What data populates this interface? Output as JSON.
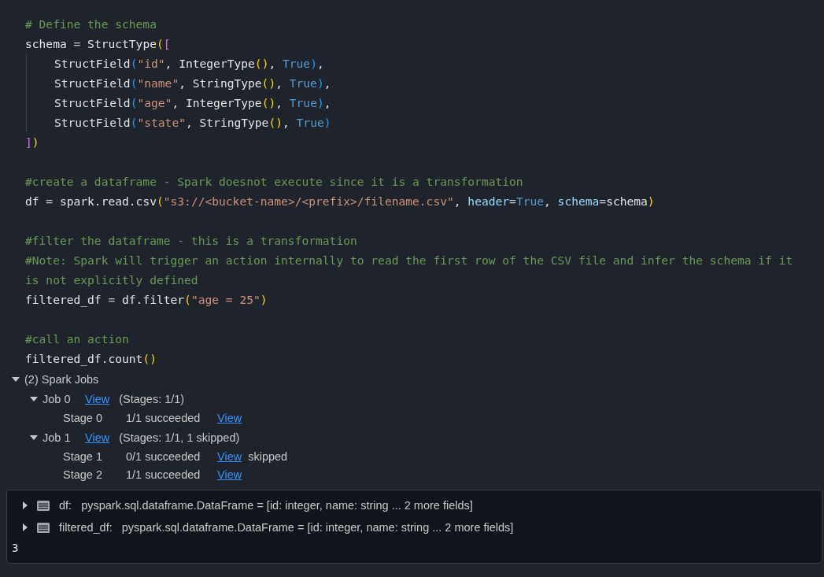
{
  "code_lines": [
    {
      "kind": "code",
      "indented": false,
      "tokens": [
        {
          "kind": "comment",
          "text": "# Define the schema"
        }
      ]
    },
    {
      "kind": "code",
      "indented": false,
      "tokens": [
        {
          "kind": "plain",
          "text": "schema "
        },
        {
          "kind": "op",
          "text": "="
        },
        {
          "kind": "plain",
          "text": " StructType"
        },
        {
          "kind": "paren1",
          "text": "("
        },
        {
          "kind": "paren2",
          "text": "["
        }
      ]
    },
    {
      "kind": "code",
      "indented": true,
      "tokens": [
        {
          "kind": "plain",
          "text": "StructField"
        },
        {
          "kind": "paren3",
          "text": "("
        },
        {
          "kind": "string",
          "text": "\"id\""
        },
        {
          "kind": "plain",
          "text": ", IntegerType"
        },
        {
          "kind": "paren1",
          "text": "()"
        },
        {
          "kind": "plain",
          "text": ", "
        },
        {
          "kind": "keyword",
          "text": "True"
        },
        {
          "kind": "paren3",
          "text": ")"
        },
        {
          "kind": "plain",
          "text": ","
        }
      ]
    },
    {
      "kind": "code",
      "indented": true,
      "tokens": [
        {
          "kind": "plain",
          "text": "StructField"
        },
        {
          "kind": "paren3",
          "text": "("
        },
        {
          "kind": "string",
          "text": "\"name\""
        },
        {
          "kind": "plain",
          "text": ", StringType"
        },
        {
          "kind": "paren1",
          "text": "()"
        },
        {
          "kind": "plain",
          "text": ", "
        },
        {
          "kind": "keyword",
          "text": "True"
        },
        {
          "kind": "paren3",
          "text": ")"
        },
        {
          "kind": "plain",
          "text": ","
        }
      ]
    },
    {
      "kind": "code",
      "indented": true,
      "tokens": [
        {
          "kind": "plain",
          "text": "StructField"
        },
        {
          "kind": "paren3",
          "text": "("
        },
        {
          "kind": "string",
          "text": "\"age\""
        },
        {
          "kind": "plain",
          "text": ", IntegerType"
        },
        {
          "kind": "paren1",
          "text": "()"
        },
        {
          "kind": "plain",
          "text": ", "
        },
        {
          "kind": "keyword",
          "text": "True"
        },
        {
          "kind": "paren3",
          "text": ")"
        },
        {
          "kind": "plain",
          "text": ","
        }
      ]
    },
    {
      "kind": "code",
      "indented": true,
      "tokens": [
        {
          "kind": "plain",
          "text": "StructField"
        },
        {
          "kind": "paren3",
          "text": "("
        },
        {
          "kind": "string",
          "text": "\"state\""
        },
        {
          "kind": "plain",
          "text": ", StringType"
        },
        {
          "kind": "paren1",
          "text": "()"
        },
        {
          "kind": "plain",
          "text": ", "
        },
        {
          "kind": "keyword",
          "text": "True"
        },
        {
          "kind": "paren3",
          "text": ")"
        }
      ]
    },
    {
      "kind": "code",
      "indented": false,
      "tokens": [
        {
          "kind": "paren2",
          "text": "]"
        },
        {
          "kind": "paren1",
          "text": ")"
        }
      ]
    },
    {
      "kind": "blank"
    },
    {
      "kind": "code",
      "indented": false,
      "tokens": [
        {
          "kind": "comment",
          "text": "#create a dataframe - Spark doesnot execute since it is a transformation"
        }
      ]
    },
    {
      "kind": "code",
      "indented": false,
      "tokens": [
        {
          "kind": "plain",
          "text": "df "
        },
        {
          "kind": "op",
          "text": "="
        },
        {
          "kind": "plain",
          "text": " spark.read.csv"
        },
        {
          "kind": "paren1",
          "text": "("
        },
        {
          "kind": "string",
          "text": "\"s3://<bucket-name>/<prefix>/filename.csv\""
        },
        {
          "kind": "plain",
          "text": ", "
        },
        {
          "kind": "param",
          "text": "header"
        },
        {
          "kind": "op",
          "text": "="
        },
        {
          "kind": "keyword",
          "text": "True"
        },
        {
          "kind": "plain",
          "text": ", "
        },
        {
          "kind": "param",
          "text": "schema"
        },
        {
          "kind": "op",
          "text": "="
        },
        {
          "kind": "plain",
          "text": "schema"
        },
        {
          "kind": "paren1",
          "text": ")"
        }
      ]
    },
    {
      "kind": "blank"
    },
    {
      "kind": "code",
      "indented": false,
      "tokens": [
        {
          "kind": "comment",
          "text": "#filter the dataframe - this is a transformation"
        }
      ]
    },
    {
      "kind": "code",
      "indented": false,
      "tokens": [
        {
          "kind": "comment",
          "text": "#Note: Spark will trigger an action internally to read the first row of the CSV file and infer the schema if it"
        }
      ]
    },
    {
      "kind": "code",
      "indented": false,
      "tokens": [
        {
          "kind": "comment",
          "text": "is not explicitly defined"
        }
      ]
    },
    {
      "kind": "code",
      "indented": false,
      "tokens": [
        {
          "kind": "plain",
          "text": "filtered_df "
        },
        {
          "kind": "op",
          "text": "="
        },
        {
          "kind": "plain",
          "text": " df.filter"
        },
        {
          "kind": "paren1",
          "text": "("
        },
        {
          "kind": "string",
          "text": "\"age = 25\""
        },
        {
          "kind": "paren1",
          "text": ")"
        }
      ]
    },
    {
      "kind": "blank"
    },
    {
      "kind": "code",
      "indented": false,
      "tokens": [
        {
          "kind": "comment",
          "text": "#call an action"
        }
      ]
    },
    {
      "kind": "code",
      "indented": false,
      "tokens": [
        {
          "kind": "plain",
          "text": "filtered_df.count"
        },
        {
          "kind": "paren1",
          "text": "()"
        }
      ]
    }
  ],
  "spark_jobs": {
    "label": "(2) Spark Jobs",
    "expanded": true,
    "jobs": [
      {
        "label": "Job 0",
        "link": "View",
        "summary": "(Stages: 1/1)",
        "expanded": true,
        "stages": [
          {
            "name": "Stage 0",
            "status": "1/1 succeeded",
            "link": "View"
          }
        ]
      },
      {
        "label": "Job 1",
        "link": "View",
        "summary": "(Stages: 1/1, 1 skipped)",
        "expanded": true,
        "stages": [
          {
            "name": "Stage 1",
            "status": "0/1 succeeded",
            "link": "View",
            "note": "skipped"
          },
          {
            "name": "Stage 2",
            "status": "1/1 succeeded",
            "link": "View"
          }
        ]
      }
    ]
  },
  "output": {
    "variables": [
      {
        "name": "df:",
        "type": "pyspark.sql.dataframe.DataFrame = [id: integer, name: string ... 2 more fields]",
        "expanded": false
      },
      {
        "name": "filtered_df:",
        "type": "pyspark.sql.dataframe.DataFrame = [id: integer, name: string ... 2 more fields]",
        "expanded": false
      }
    ],
    "result": "3"
  }
}
